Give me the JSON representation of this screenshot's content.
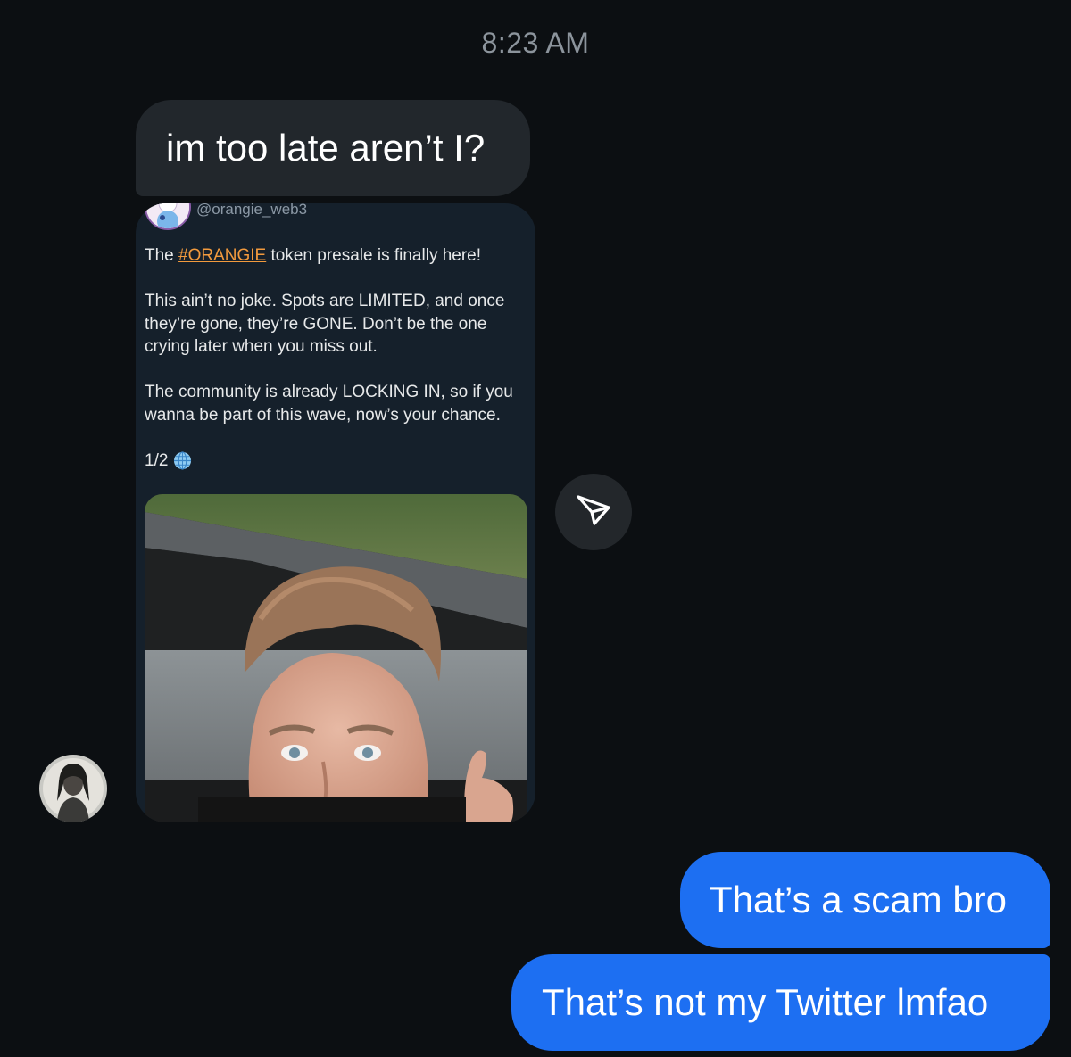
{
  "timestamp": "8:23 AM",
  "incoming": {
    "message": "im too late aren’t I?"
  },
  "shared_tweet": {
    "handle": "@orangie_web3",
    "line1_before": "The ",
    "hashtag": "#ORANGIE",
    "line1_after": " token presale is finally here!",
    "paragraph2": "This ain’t no joke. Spots are LIMITED, and once they’re gone, they’re GONE. Don’t be the one crying later when you miss out.",
    "paragraph3": "The community is already LOCKING IN, so if you wanna be part of this wave, now’s your chance.",
    "thread_counter": "1/2",
    "globe_icon": "globe-icon",
    "hashtag_color": "#f29a3d"
  },
  "share_icon": "paper-plane-icon",
  "outgoing": [
    {
      "message": "That’s a scam bro"
    },
    {
      "message": "That’s not my Twitter lmfao"
    }
  ],
  "colors": {
    "background": "#0c0f12",
    "incoming_bubble": "#22272c",
    "outgoing_bubble": "#1d6ff2",
    "tweet_card": "#15202b"
  }
}
